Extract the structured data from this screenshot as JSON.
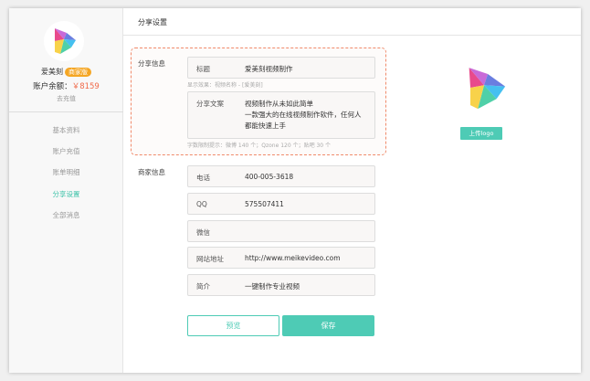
{
  "sidebar": {
    "username": "爱美刻",
    "badge": "商家版",
    "balance_label": "账户余额：",
    "balance": "￥8159",
    "recharge": "去充值",
    "items": [
      {
        "label": "基本资料"
      },
      {
        "label": "账户充值"
      },
      {
        "label": "账单明细"
      },
      {
        "label": "分享设置",
        "active": true
      },
      {
        "label": "全部消息"
      }
    ]
  },
  "header": {
    "title": "分享设置"
  },
  "share": {
    "section_label": "分享信息",
    "title_key": "标题",
    "title_value": "爱美刻视频制作",
    "title_hint": "显示效果：视频名称 - [爱美刻]",
    "text_key": "分享文案",
    "text_lines": [
      "视频制作从未如此简单",
      "一款强大的在线视频制作软件，任何人",
      "都能快速上手"
    ],
    "text_hint": "字数限制提示：微博 140 个；Qzone 120 个；贴吧 30 个"
  },
  "merchant": {
    "section_label": "商家信息",
    "fields": [
      {
        "key": "电话",
        "value": "400-005-3618"
      },
      {
        "key": "QQ",
        "value": "575507411"
      },
      {
        "key": "微信",
        "value": ""
      },
      {
        "key": "网站地址",
        "value": "http://www.meikevideo.com"
      },
      {
        "key": "简介",
        "value": "一键制作专业视频"
      }
    ]
  },
  "buttons": {
    "preview": "预览",
    "save": "保存",
    "upload_logo": "上传logo"
  },
  "colors": {
    "accent": "#4ecbb5",
    "badge": "#f5a623",
    "price": "#f06a4a",
    "dashed_border": "#f08a6a"
  }
}
